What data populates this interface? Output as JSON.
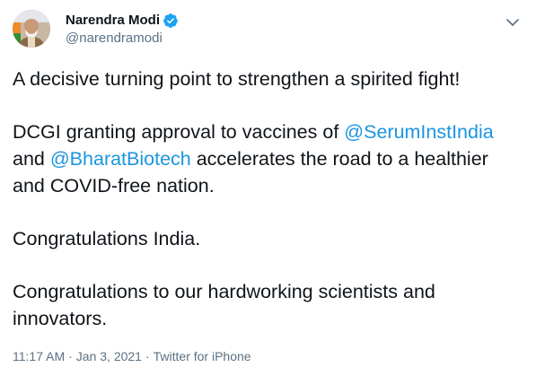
{
  "author": {
    "name": "Narendra Modi",
    "handle": "@narendramodi",
    "verified": true
  },
  "tweet": {
    "line1": "A decisive turning point to strengthen a spirited fight!",
    "p2_before": "DCGI granting approval to vaccines of ",
    "mention1": "@SerumInstIndia",
    "p2_and": "and ",
    "mention2": "@BharatBiotech",
    "p2_after": " accelerates the road to a healthier",
    "p2_line3": "and COVID-free nation.",
    "line3": "Congratulations India.",
    "line4a": "Congratulations to our hardworking scientists and",
    "line4b": "innovators."
  },
  "footer": {
    "time": "11:17 AM",
    "date": "Jan 3, 2021",
    "source": "Twitter for iPhone",
    "separator": "·"
  },
  "colors": {
    "link": "#1b95e0",
    "muted": "#5b7083",
    "text": "#0f1419",
    "verified_badge": "#1da1f2"
  },
  "icons": [
    "avatar-photo",
    "verified-badge-icon",
    "chevron-down-icon"
  ]
}
